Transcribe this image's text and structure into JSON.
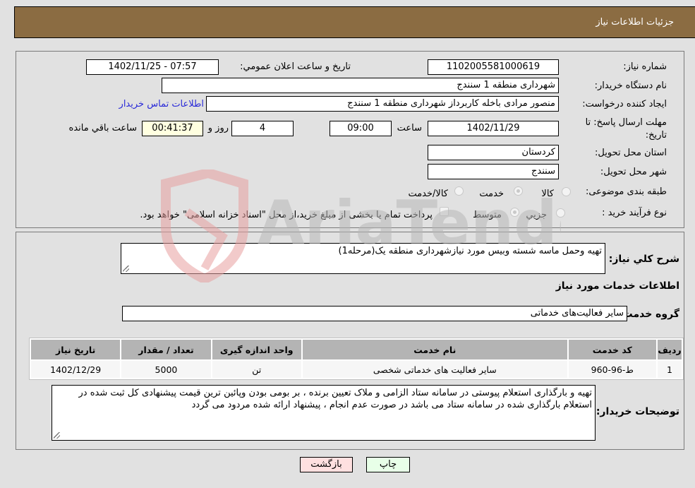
{
  "header": {
    "title": "جزئیات اطلاعات نیاز"
  },
  "details": {
    "need_number_label": "شماره نیاز:",
    "need_number": "1102005581000619",
    "announce_label": "تاریخ و ساعت اعلان عمومي:",
    "announce_value": "1402/11/25 - 07:57",
    "buyer_org_label": "نام دستگاه خریدار:",
    "buyer_org": "شهرداری منطقه 1 سنندج",
    "requester_label": "ایجاد کننده درخواست:",
    "requester": "منصور مرادی باخله کاربرداز شهرداری منطقه 1 سنندج",
    "contact_link": "اطلاعات تماس خریدار",
    "deadline_label_1": "مهلت ارسال پاسخ: تا",
    "deadline_label_2": "تاریخ:",
    "deadline_date": "1402/11/29",
    "time_label": "ساعت",
    "deadline_time": "09:00",
    "days_value": "4",
    "days_label": "روز و",
    "remaining_time": "00:41:37",
    "remaining_label": "ساعت باقي مانده",
    "province_label": "استان محل تحویل:",
    "province": "کردستان",
    "city_label": "شهر محل تحویل:",
    "city": "سنندج",
    "category_label": "طبقه بندی موضوعی:",
    "category_options": [
      {
        "label": "کالا",
        "checked": false
      },
      {
        "label": "خدمت",
        "checked": true
      },
      {
        "label": "کالا/خدمت",
        "checked": false
      }
    ],
    "process_label": "نوع فرآیند خرید :",
    "process_options": [
      {
        "label": "جزيي",
        "checked": false
      },
      {
        "label": "متوسط",
        "checked": true
      }
    ],
    "treasury_note": "پرداخت تمام یا بخشی از مبلغ خرید،از محل \"اسناد خزانه اسلامی\" خواهد بود.",
    "treasury_checked": false
  },
  "services": {
    "summary_label": "شرح کلي نیاز:",
    "summary": "تهیه  وحمل ماسه شسته وبیس مورد نیازشهرداری منطقه یک(مرحله1)",
    "section_title": "اطلاعات خدمات مورد نیاز",
    "group_label": "گروه خدمت:",
    "group_value": "سایر فعالیت‌های خدماتی",
    "table": {
      "headers": [
        "ردیف",
        "کد خدمت",
        "نام خدمت",
        "واحد اندازه گیری",
        "تعداد / مقدار",
        "تاریخ نیاز"
      ],
      "rows": [
        [
          "1",
          "ط-96-960",
          "سایر فعالیت های خدماتی شخصی",
          "تن",
          "5000",
          "1402/12/29"
        ]
      ]
    },
    "buyer_notes_label": "توضیحات خریدار:",
    "buyer_notes": "تهیه و بارگذاری استعلام پیوستی در سامانه ستاد الزامی و ملاک تعیین برنده ، بر بومی بودن وپائین ترین قیمت پیشنهادی کل ثبت شده در استعلام بارگذاری شده در سامانه ستاد می باشد در صورت عدم انجام ، پیشنهاد ارائه شده مردود می گردد"
  },
  "buttons": {
    "print": "چاپ",
    "back": "بازگشت"
  },
  "watermark": {
    "text": "AriaTender.neT"
  }
}
